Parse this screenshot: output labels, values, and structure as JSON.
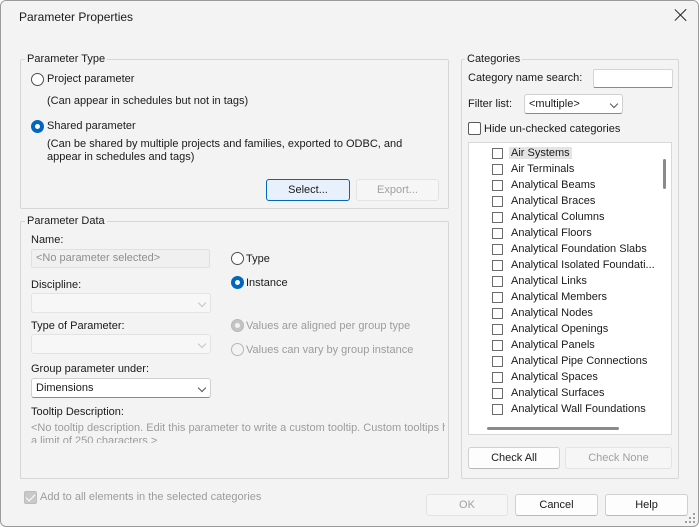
{
  "dialog": {
    "title": "Parameter Properties"
  },
  "parameter_type": {
    "legend": "Parameter Type",
    "project_label": "Project parameter",
    "project_desc": "(Can appear in schedules but not in tags)",
    "shared_label": "Shared parameter",
    "shared_desc_1": "(Can be shared by multiple projects and families, exported to ODBC, and",
    "shared_desc_2": "appear in schedules and tags)",
    "selected": "shared",
    "select_button": "Select...",
    "export_button": "Export..."
  },
  "parameter_data": {
    "legend": "Parameter Data",
    "name_label": "Name:",
    "name_placeholder": "<No parameter selected>",
    "type_radio": "Type",
    "instance_radio": "Instance",
    "instance_selected": true,
    "discipline_label": "Discipline:",
    "discipline_value": "",
    "type_of_parameter_label": "Type of Parameter:",
    "type_of_parameter_value": "",
    "aligned_radio": "Values are aligned per group type",
    "vary_radio": "Values can vary by group instance",
    "group_label": "Group parameter under:",
    "group_value": "Dimensions",
    "tooltip_label": "Tooltip Description:",
    "tooltip_text_1": "<No tooltip description. Edit this parameter to write a custom tooltip. Custom tooltips have",
    "tooltip_text_2": "a limit of 250 characters.>"
  },
  "categories": {
    "legend": "Categories",
    "search_label": "Category name search:",
    "search_value": "",
    "filter_label": "Filter list:",
    "filter_value": "<multiple>",
    "hide_unchecked_label": "Hide un-checked categories",
    "items": [
      "Air Systems",
      "Air Terminals",
      "Analytical Beams",
      "Analytical Braces",
      "Analytical Columns",
      "Analytical Floors",
      "Analytical Foundation Slabs",
      "Analytical Isolated Foundati...",
      "Analytical Links",
      "Analytical Members",
      "Analytical Nodes",
      "Analytical Openings",
      "Analytical Panels",
      "Analytical Pipe Connections",
      "Analytical Spaces",
      "Analytical Surfaces",
      "Analytical Wall Foundations"
    ],
    "check_all": "Check All",
    "check_none": "Check None"
  },
  "footer": {
    "add_all_label": "Add to all elements in the selected categories",
    "ok": "OK",
    "cancel": "Cancel",
    "help": "Help"
  }
}
